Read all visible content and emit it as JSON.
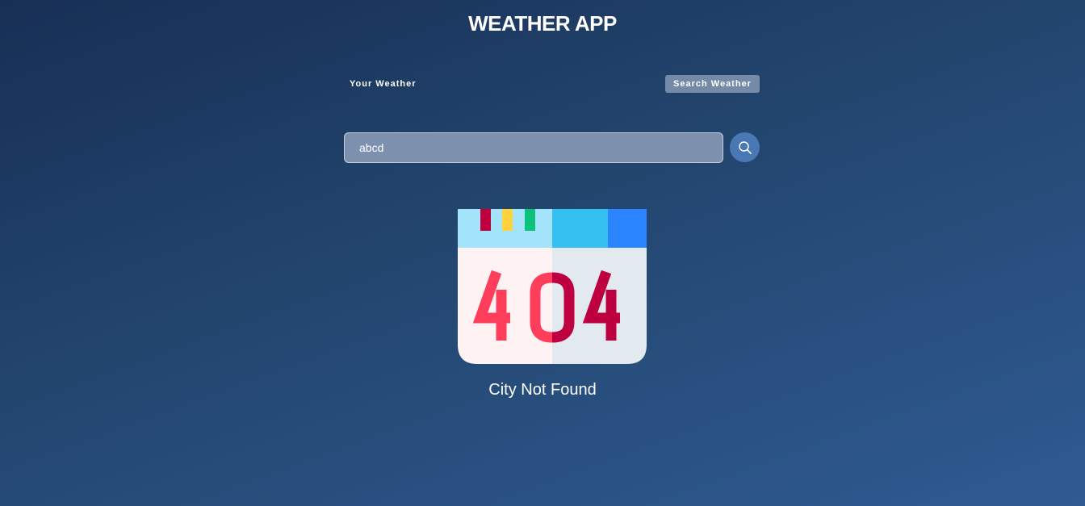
{
  "app": {
    "title": "WEATHER APP"
  },
  "tabs": {
    "your_weather": "Your Weather",
    "search_weather": "Search Weather"
  },
  "search": {
    "value": "abcd",
    "icon": "search-icon"
  },
  "error": {
    "illustration_text": "404",
    "message": "City Not Found"
  },
  "colors": {
    "background_start": "#172f55",
    "background_end": "#2f5a92",
    "search_button": "#4a78b4",
    "error_red": "#ff3e5c",
    "error_dark_red": "#bf0040"
  }
}
